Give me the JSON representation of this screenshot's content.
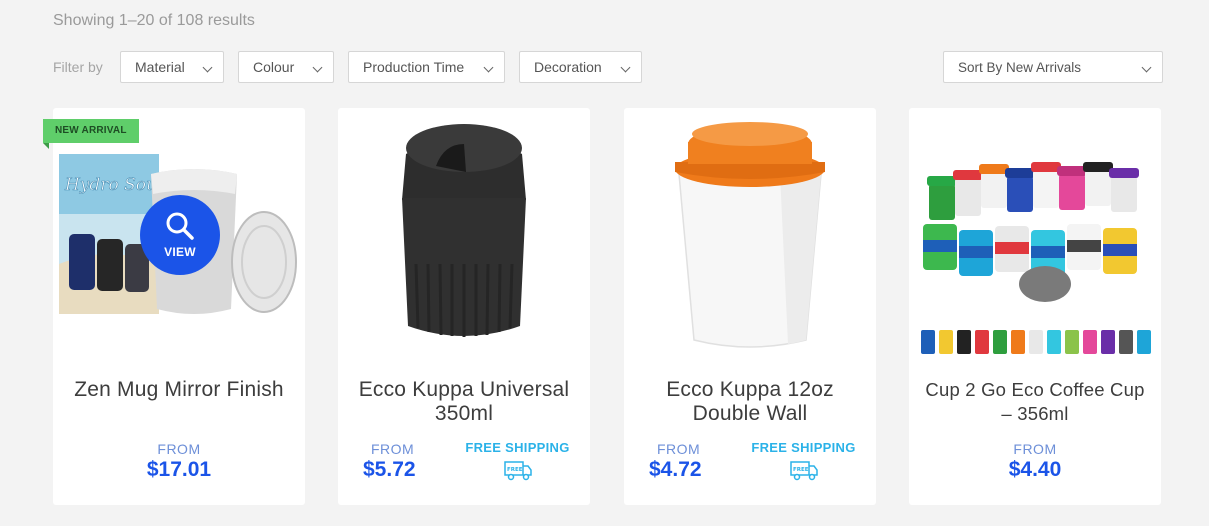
{
  "results_text": "Showing 1–20 of 108 results",
  "filter": {
    "label": "Filter by",
    "material": "Material",
    "colour": "Colour",
    "production": "Production Time",
    "decoration": "Decoration"
  },
  "sort": {
    "selected": "Sort By New Arrivals"
  },
  "products": [
    {
      "badge": "NEW ARRIVAL",
      "view": "VIEW",
      "title": "Zen Mug Mirror Finish",
      "from": "FROM",
      "price": "$17.01",
      "image": "zen-mug-photo",
      "logo_text": "Hydro Soul"
    },
    {
      "title": "Ecco Kuppa Universal 350ml",
      "from": "FROM",
      "price": "$5.72",
      "shipping": "FREE SHIPPING",
      "truck_text": "FREE",
      "image": "black-cup-photo"
    },
    {
      "title": "Ecco Kuppa 12oz Double Wall",
      "from": "FROM",
      "price": "$4.72",
      "shipping": "FREE SHIPPING",
      "truck_text": "FREE",
      "image": "white-orange-cup-photo"
    },
    {
      "title": "Cup 2 Go Eco Coffee Cup – 356ml",
      "from": "FROM",
      "price": "$4.40",
      "image": "colorful-cups-photo"
    }
  ],
  "colors": {
    "accent": "#1b54e8",
    "shipping": "#2bb2e8",
    "badge": "#5fce6a",
    "background": "#f3f3f3"
  }
}
